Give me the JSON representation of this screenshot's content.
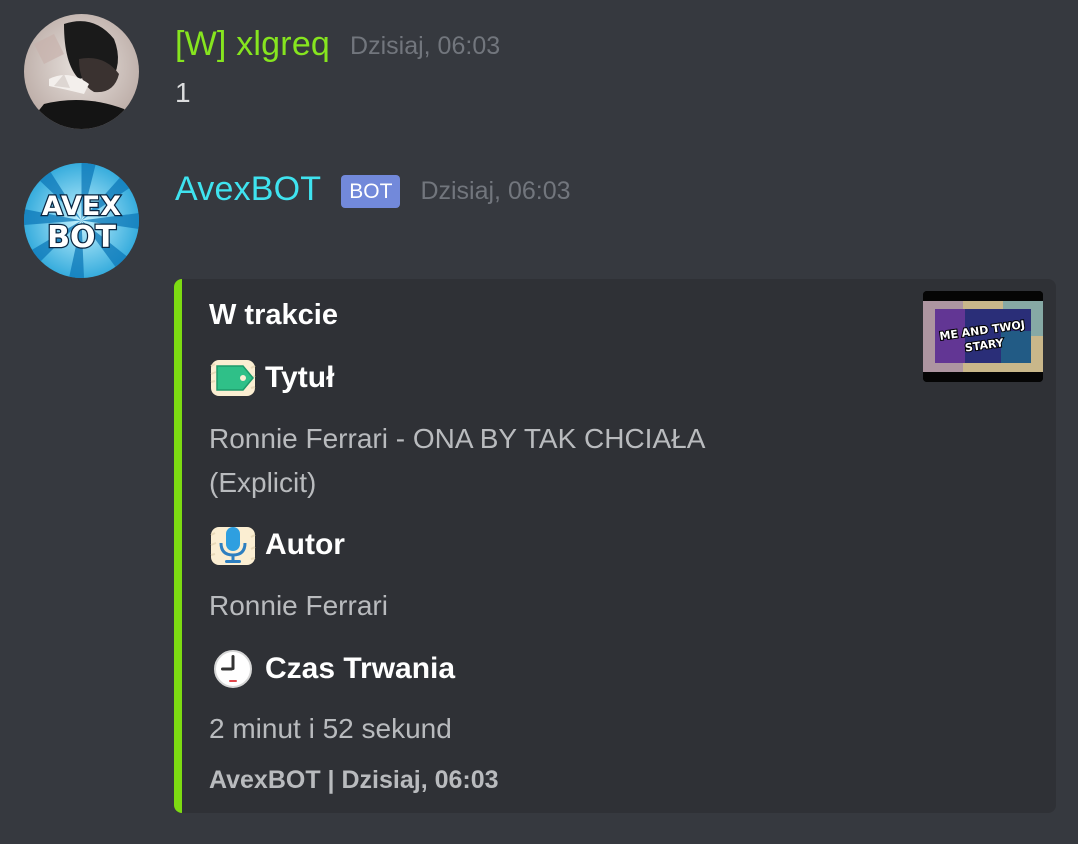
{
  "messages": [
    {
      "username": "[W] xlgreq",
      "timestamp": "Dzisiaj, 06:03",
      "content": "1",
      "username_color": "#86e51f"
    },
    {
      "username": "AvexBOT",
      "bot_tag": "BOT",
      "timestamp": "Dzisiaj, 06:03",
      "username_color": "#3fe3ef",
      "avatar_text": [
        "AVEX",
        "BOT"
      ],
      "embed": {
        "accent_color": "#7ddb12",
        "title": "W trakcie",
        "fields": [
          {
            "icon": "label-tag-icon",
            "name": "Tytuł",
            "value": "Ronnie Ferrari - ONA BY TAK CHCIAŁA (Explicit)"
          },
          {
            "icon": "microphone-icon",
            "name": "Autor",
            "value": "Ronnie Ferrari"
          },
          {
            "icon": "clock-icon",
            "name": "Czas Trwania",
            "value": "2 minut i 52 sekund"
          }
        ],
        "footer": "AvexBOT | Dzisiaj, 06:03",
        "thumbnail_text": [
          "ME AND TWOJ",
          "STARY"
        ]
      }
    }
  ]
}
